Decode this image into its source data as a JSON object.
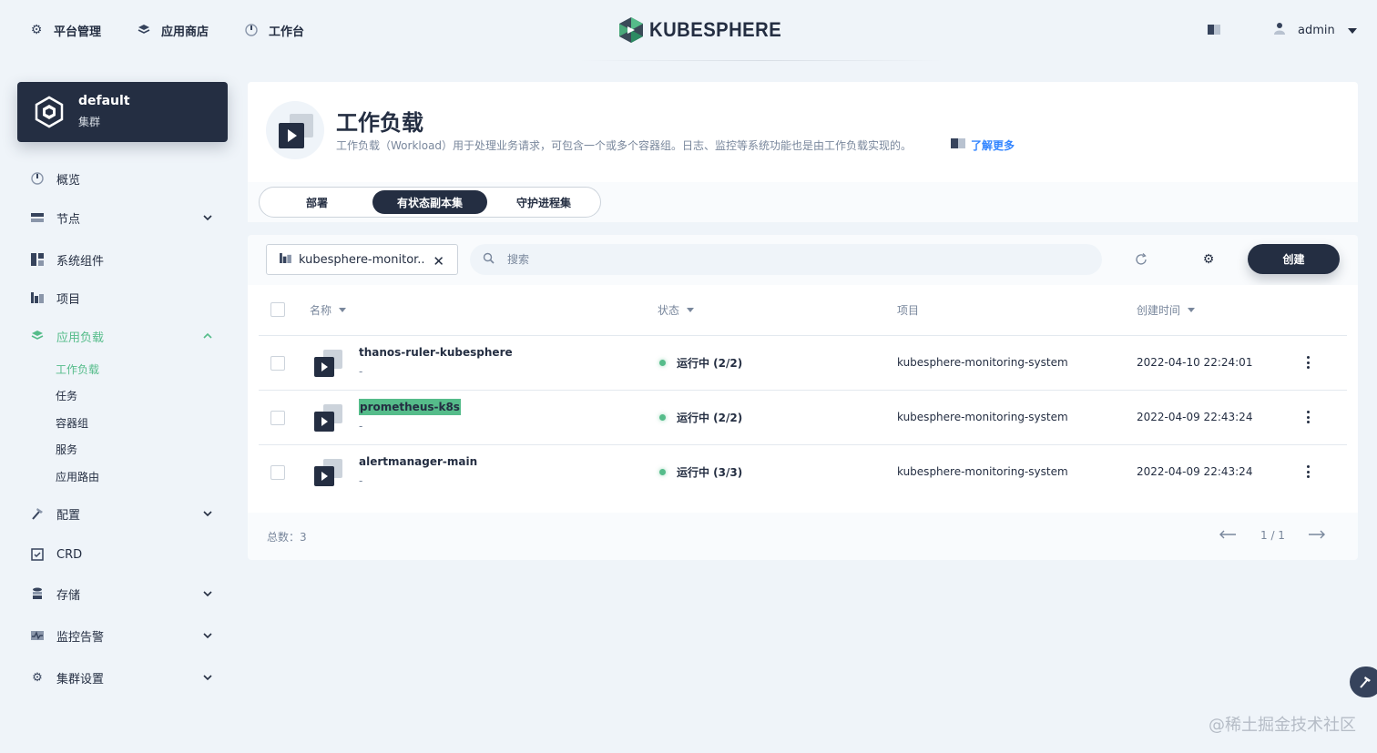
{
  "topnav": {
    "platform": "平台管理",
    "appstore": "应用商店",
    "workbench": "工作台",
    "logo": "KUBESPHERE",
    "user": "admin"
  },
  "cluster": {
    "name": "default",
    "subtitle": "集群"
  },
  "sidebar": {
    "items": [
      {
        "label": "概览",
        "icon": "dashboard-icon"
      },
      {
        "label": "节点",
        "icon": "nodes-icon"
      },
      {
        "label": "系统组件",
        "icon": "components-icon"
      },
      {
        "label": "项目",
        "icon": "project-icon"
      },
      {
        "label": "应用负载",
        "icon": "appcenter-icon"
      },
      {
        "label": "配置",
        "icon": "hammer-icon"
      },
      {
        "label": "CRD",
        "icon": "crd-icon"
      },
      {
        "label": "存储",
        "icon": "storage-icon"
      },
      {
        "label": "监控告警",
        "icon": "monitor-icon"
      },
      {
        "label": "集群设置",
        "icon": "settings-icon"
      }
    ],
    "subitems": [
      "工作负载",
      "任务",
      "容器组",
      "服务",
      "应用路由"
    ]
  },
  "header": {
    "title": "工作负载",
    "description": "工作负载（Workload）用于处理业务请求，可包含一个或多个容器组。日志、监控等系统功能也是由工作负载实现的。",
    "learn_more": "了解更多"
  },
  "tabs": [
    "部署",
    "有状态副本集",
    "守护进程集"
  ],
  "toolbar": {
    "project_filter": "kubesphere-monitor...",
    "search_placeholder": "搜索",
    "create_label": "创建"
  },
  "table": {
    "columns": [
      "名称",
      "状态",
      "项目",
      "创建时间"
    ],
    "rows": [
      {
        "name": "thanos-ruler-kubesphere",
        "desc": "-",
        "status": "运行中 (2/2)",
        "project": "kubesphere-monitoring-system",
        "created": "2022-04-10 22:24:01"
      },
      {
        "name": "prometheus-k8s",
        "desc": "-",
        "status": "运行中 (2/2)",
        "project": "kubesphere-monitoring-system",
        "created": "2022-04-09 22:43:24"
      },
      {
        "name": "alertmanager-main",
        "desc": "-",
        "status": "运行中 (3/3)",
        "project": "kubesphere-monitoring-system",
        "created": "2022-04-09 22:43:24"
      }
    ]
  },
  "footer": {
    "total": "总数：3",
    "page": "1 / 1"
  },
  "watermark": "@稀土掘金技术社区",
  "colors": {
    "accent": "#55bc8a",
    "dark": "#242e42",
    "link": "#3385ff"
  }
}
